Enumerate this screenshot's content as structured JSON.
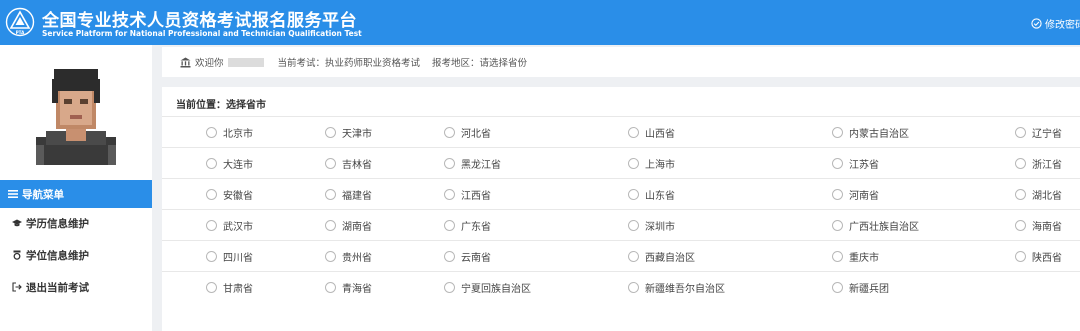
{
  "header": {
    "title_cn": "全国专业技术人员资格考试报名服务平台",
    "title_en": "Service Platform for National Professional and Technician Qualification Test",
    "logo_text": "PTA",
    "change_password": "修改密码",
    "accent_color": "#2a8ee8"
  },
  "sidebar": {
    "nav_menu": "导航菜单",
    "items": [
      {
        "label": "学历信息维护",
        "icon": "graduation-cap-icon"
      },
      {
        "label": "学位信息维护",
        "icon": "degree-badge-icon"
      },
      {
        "label": "退出当前考试",
        "icon": "exit-icon"
      }
    ]
  },
  "info_bar": {
    "welcome": "欢迎你",
    "current_exam": "当前考试：执业药师职业资格考试",
    "exam_region": "报考地区：请选择省份"
  },
  "location": "当前位置：选择省市",
  "regions": [
    [
      "北京市",
      "天津市",
      "河北省",
      "山西省",
      "内蒙古自治区",
      "辽宁省"
    ],
    [
      "大连市",
      "吉林省",
      "黑龙江省",
      "上海市",
      "江苏省",
      "浙江省"
    ],
    [
      "安徽省",
      "福建省",
      "江西省",
      "山东省",
      "河南省",
      "湖北省"
    ],
    [
      "武汉市",
      "湖南省",
      "广东省",
      "深圳市",
      "广西壮族自治区",
      "海南省"
    ],
    [
      "四川省",
      "贵州省",
      "云南省",
      "西藏自治区",
      "重庆市",
      "陕西省"
    ],
    [
      "甘肃省",
      "青海省",
      "宁夏回族自治区",
      "新疆维吾尔自治区",
      "新疆兵团"
    ]
  ]
}
